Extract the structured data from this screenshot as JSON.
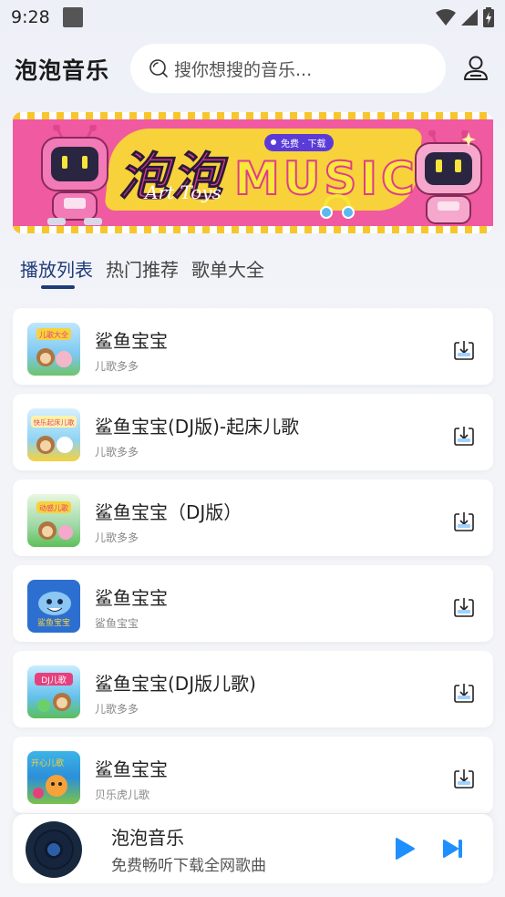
{
  "status_bar": {
    "time": "9:28"
  },
  "header": {
    "app_title": "泡泡音乐",
    "search_placeholder": "搜你想搜的音乐..."
  },
  "banner": {
    "cn_title": "泡泡",
    "music_text": "MUSIC",
    "art_text": "Art Toys",
    "badge_text": "免费 · 下载"
  },
  "tabs": [
    {
      "label": "播放列表",
      "active": true
    },
    {
      "label": "热门推荐",
      "active": false
    },
    {
      "label": "歌单大全",
      "active": false
    }
  ],
  "songs": [
    {
      "title": "鲨鱼宝宝",
      "artist": "儿歌多多",
      "cover_text": "儿歌大全",
      "cover_color": "#7cc8f0"
    },
    {
      "title": "鲨鱼宝宝(DJ版)-起床儿歌",
      "artist": "儿歌多多",
      "cover_text": "快乐起床儿歌",
      "cover_color": "#8fd3f2"
    },
    {
      "title": "鲨鱼宝宝（DJ版）",
      "artist": "儿歌多多",
      "cover_text": "动感儿歌",
      "cover_color": "#9ed8a6"
    },
    {
      "title": "鲨鱼宝宝",
      "artist": "鲨鱼宝宝",
      "cover_text": "鲨鱼宝宝",
      "cover_color": "#2d6fd0"
    },
    {
      "title": "鲨鱼宝宝(DJ版儿歌)",
      "artist": "儿歌多多",
      "cover_text": "DJ儿歌",
      "cover_color": "#63c0ec"
    },
    {
      "title": "鲨鱼宝宝",
      "artist": "贝乐虎儿歌",
      "cover_text": "开心儿歌",
      "cover_color": "#3bb4e8"
    }
  ],
  "player": {
    "title": "泡泡音乐",
    "subtitle": "免费畅听下载全网歌曲"
  },
  "colors": {
    "accent": "#1f3b78",
    "play_blue": "#1f8fff",
    "banner_pink": "#f05aa0",
    "banner_yellow": "#f7d23a"
  }
}
